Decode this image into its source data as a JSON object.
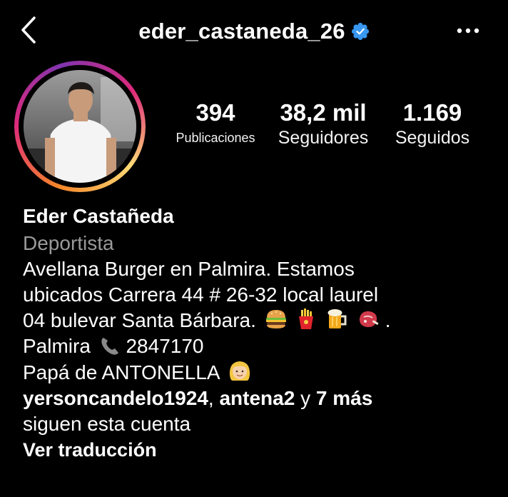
{
  "header": {
    "username": "eder_castaneda_26",
    "verified": true,
    "icons": {
      "back": "chevron-left-icon",
      "verified": "verified-badge-icon",
      "more": "more-horizontal-icon"
    }
  },
  "stats": {
    "posts": {
      "value": "394",
      "label": "Publicaciones"
    },
    "followers": {
      "value": "38,2 mil",
      "label": "Seguidores"
    },
    "following": {
      "value": "1.169",
      "label": "Seguidos"
    }
  },
  "bio": {
    "full_name": "Eder Castañeda",
    "category": "Deportista",
    "line1": "Avellana Burger en Palmira. Estamos",
    "line2": "ubicados Carrera 44 # 26-32 local laurel",
    "line3": "04 bulevar Santa Bárbara.",
    "line3_end": ".",
    "line4_prefix": "Palmira",
    "line4_phone": "2847170",
    "line5": "Papá de ANTONELLA",
    "emojis": [
      "burger-emoji",
      "fries-emoji",
      "beer-emoji",
      "meat-emoji",
      "phone-emoji",
      "girl-emoji"
    ]
  },
  "followed_by": {
    "user1": "yersoncandelo1924",
    "sep": ",",
    "user2": "antena2",
    "connector": "y",
    "more": "7 más",
    "suffix": "siguen esta cuenta"
  },
  "translate_label": "Ver traducción",
  "colors": {
    "background": "#000000",
    "text": "#ffffff",
    "muted": "#9a9a9a",
    "verified_blue": "#3897f0"
  }
}
